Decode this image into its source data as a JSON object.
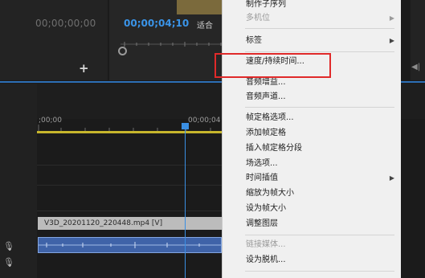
{
  "source_monitor": {
    "timecode": "00;00;00;00",
    "add_symbol": "+"
  },
  "program_monitor": {
    "timecode": "00;00;04;10",
    "fit_label": "适合"
  },
  "timeline": {
    "ruler_start": ";00;00",
    "ruler_mid": "00;00;04",
    "video_clip_label": "V3D_20201120_220448.mp4 [V]"
  },
  "right_panel_arrow": "◀|",
  "context_menu": {
    "items": [
      {
        "label": "制作子序列",
        "enabled": true,
        "submenu": false
      },
      {
        "label": "多机位",
        "enabled": false,
        "submenu": true
      },
      {
        "label": "标签",
        "enabled": true,
        "submenu": true
      },
      {
        "label": "速度/持续时间...",
        "enabled": true,
        "submenu": false
      },
      {
        "label": "音频增益...",
        "enabled": true,
        "submenu": false
      },
      {
        "label": "音频声道...",
        "enabled": true,
        "submenu": false
      },
      {
        "label": "帧定格选项...",
        "enabled": true,
        "submenu": false
      },
      {
        "label": "添加帧定格",
        "enabled": true,
        "submenu": false
      },
      {
        "label": "插入帧定格分段",
        "enabled": true,
        "submenu": false
      },
      {
        "label": "场选项...",
        "enabled": true,
        "submenu": false
      },
      {
        "label": "时间插值",
        "enabled": true,
        "submenu": true
      },
      {
        "label": "缩放为帧大小",
        "enabled": true,
        "submenu": false
      },
      {
        "label": "设为帧大小",
        "enabled": true,
        "submenu": false
      },
      {
        "label": "调整图层",
        "enabled": true,
        "submenu": false
      },
      {
        "label": "链接媒体...",
        "enabled": false,
        "submenu": false
      },
      {
        "label": "设为脱机...",
        "enabled": true,
        "submenu": false
      }
    ],
    "highlighted_item": "速度/持续时间..."
  },
  "colors": {
    "accent_blue": "#3a8fe3",
    "highlight_red": "#e02a2a",
    "ruler_yellow": "#c7b62c"
  }
}
